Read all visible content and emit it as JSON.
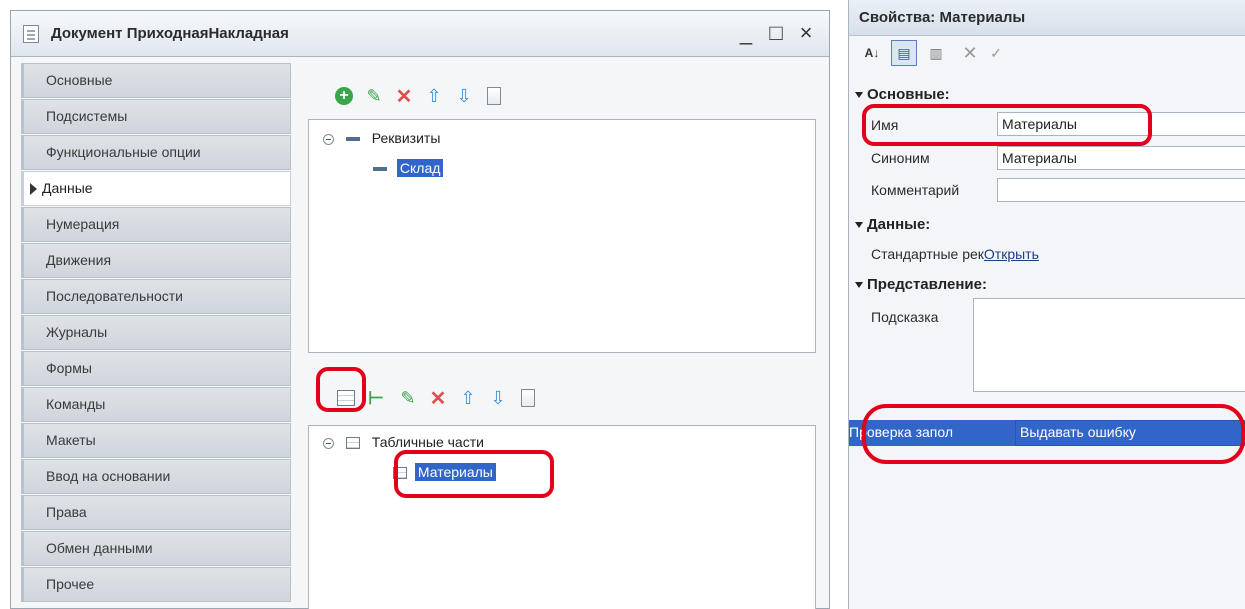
{
  "window": {
    "title": "Документ ПриходнаяНакладная",
    "minimize": "_",
    "maximize": "□",
    "close": "×"
  },
  "nav": {
    "items": [
      {
        "label": "Основные"
      },
      {
        "label": "Подсистемы"
      },
      {
        "label": "Функциональные опции"
      },
      {
        "label": "Данные",
        "active": true
      },
      {
        "label": "Нумерация"
      },
      {
        "label": "Движения"
      },
      {
        "label": "Последовательности"
      },
      {
        "label": "Журналы"
      },
      {
        "label": "Формы"
      },
      {
        "label": "Команды"
      },
      {
        "label": "Макеты"
      },
      {
        "label": "Ввод на основании"
      },
      {
        "label": "Права"
      },
      {
        "label": "Обмен данными"
      },
      {
        "label": "Прочее"
      }
    ]
  },
  "attributes": {
    "group_label": "Реквизиты",
    "items": [
      {
        "label": "Склад"
      }
    ]
  },
  "tabular": {
    "group_label": "Табличные части",
    "items": [
      {
        "label": "Материалы"
      }
    ]
  },
  "properties": {
    "title": "Свойства: Материалы",
    "sections": {
      "main": "Основные:",
      "data": "Данные:",
      "presentation": "Представление:"
    },
    "name_label": "Имя",
    "name_value": "Материалы",
    "synonym_label": "Синоним",
    "synonym_value": "Материалы",
    "comment_label": "Комментарий",
    "comment_value": "",
    "standard_attrs_label": "Стандартные рек",
    "standard_attrs_link": "Открыть",
    "tooltip_label": "Подсказка",
    "fill_check_label": "Проверка запол",
    "fill_check_value": "Выдавать ошибку"
  },
  "colors": {
    "selection": "#3166c8",
    "highlight_ring": "#e3001b"
  }
}
